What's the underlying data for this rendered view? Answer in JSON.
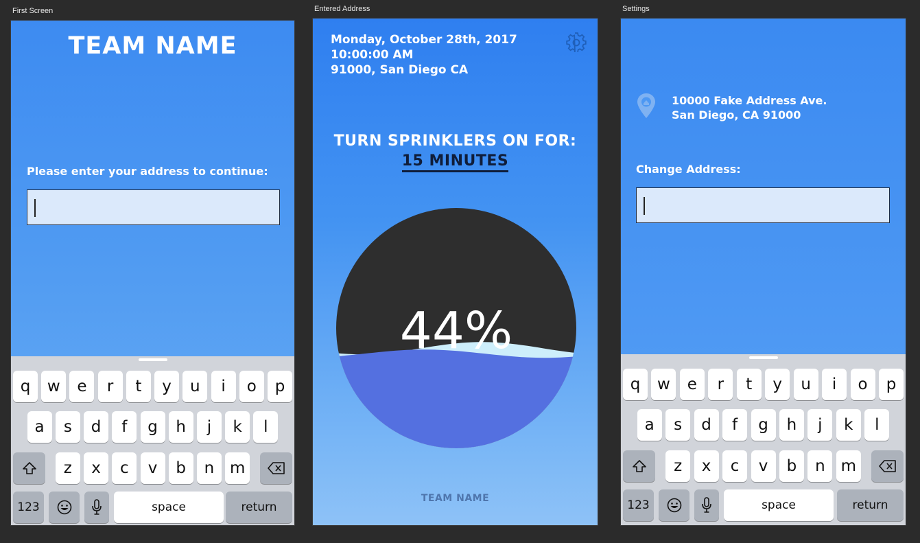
{
  "artboards": {
    "first": "First Screen",
    "entered": "Entered Address",
    "settings": "Settings"
  },
  "first_screen": {
    "title": "TEAM NAME",
    "prompt": "Please enter your address to continue:",
    "address_input": {
      "value": "",
      "placeholder": ""
    }
  },
  "entered_address": {
    "date": "Monday, October 28th, 2017",
    "time": "10:00:00 AM",
    "location": "91000, San Diego CA",
    "instruction": "TURN SPRINKLERS ON FOR:",
    "duration": "15 MINUTES",
    "gauge": {
      "percent_label": "44%",
      "fill_fraction": 0.44
    },
    "footer": "TEAM NAME",
    "icons": {
      "settings": "gear-icon"
    }
  },
  "settings": {
    "address_line1": "10000 Fake Address Ave.",
    "address_line2": "San Diego, CA 91000",
    "change_label": "Change Address:",
    "address_input": {
      "value": "",
      "placeholder": ""
    },
    "icons": {
      "location": "location-pin-icon"
    }
  },
  "keyboard": {
    "row1": [
      "q",
      "w",
      "e",
      "r",
      "t",
      "y",
      "u",
      "i",
      "o",
      "p"
    ],
    "row2": [
      "a",
      "s",
      "d",
      "f",
      "g",
      "h",
      "j",
      "k",
      "l"
    ],
    "row3": [
      "z",
      "x",
      "c",
      "v",
      "b",
      "n",
      "m"
    ],
    "numbers": "123",
    "space": "space",
    "return": "return"
  },
  "colors": {
    "screen_blue": "#3d8bf1",
    "water": "#5470e0",
    "gauge_empty": "#2e2e2e",
    "input_bg": "#dbe9fb"
  }
}
